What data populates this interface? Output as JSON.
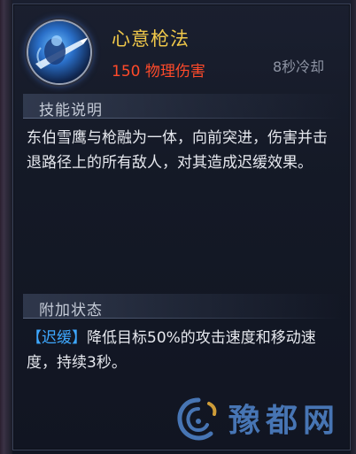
{
  "skill": {
    "name": "心意枪法",
    "damage": "150 物理伤害",
    "cooldown": "8秒冷却"
  },
  "sections": {
    "description": {
      "title": "技能说明",
      "text": "东伯雪鹰与枪融为一体，向前突进，伤害并击退路径上的所有敌人，对其造成迟缓效果。"
    },
    "status": {
      "title": "附加状态",
      "tag": "【迟缓】",
      "text": "降低目标50%的攻击速度和移动速度，持续3秒。"
    }
  },
  "watermark": {
    "text": "豫都网"
  },
  "colors": {
    "skill_name": "#f0c84a",
    "damage": "#ff4a2a",
    "cooldown": "#8e94a4",
    "status_tag": "#3ea8ff"
  }
}
